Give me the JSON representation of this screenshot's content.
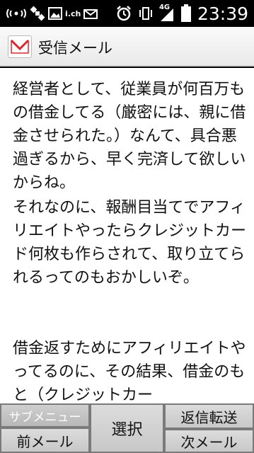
{
  "status_bar": {
    "time": "23:39",
    "network": "4G",
    "ich_label": "i.ch",
    "icons": [
      "wifi-signal-icon",
      "satellite-icon",
      "image-icon",
      "ich-icon",
      "mail-icon",
      "alarm-icon",
      "vibrate-icon",
      "signal-icon",
      "battery-icon"
    ]
  },
  "header": {
    "title": "受信メール",
    "icon": "mail-icon"
  },
  "message": {
    "paragraphs": [
      "経営者として、従業員が何百万もの借金してる（厳密には、親に借金させられた。）なんて、具合悪過ぎるから、早く完済して欲しいからね。",
      "それなのに、報酬目当てでアフィリエイトやったらクレジットカード何枚も作らされて、取り立てられるってのもおかしいぞ。",
      "借金返すためにアフィリエイトやってるのに、その結果、借金のもと（クレジットカー"
    ]
  },
  "softkeys": {
    "sub_menu": "サブメニュー",
    "prev_mail": "前メール",
    "select": "選択",
    "reply_forward": "返信転送",
    "next_mail": "次メール"
  },
  "colors": {
    "status_bg": "#000000",
    "title_bg": "#f2f2f2",
    "content_bg": "#ffffff",
    "softkey_bg": "#d4d4d4",
    "mail_icon_red": "#d7282f"
  }
}
